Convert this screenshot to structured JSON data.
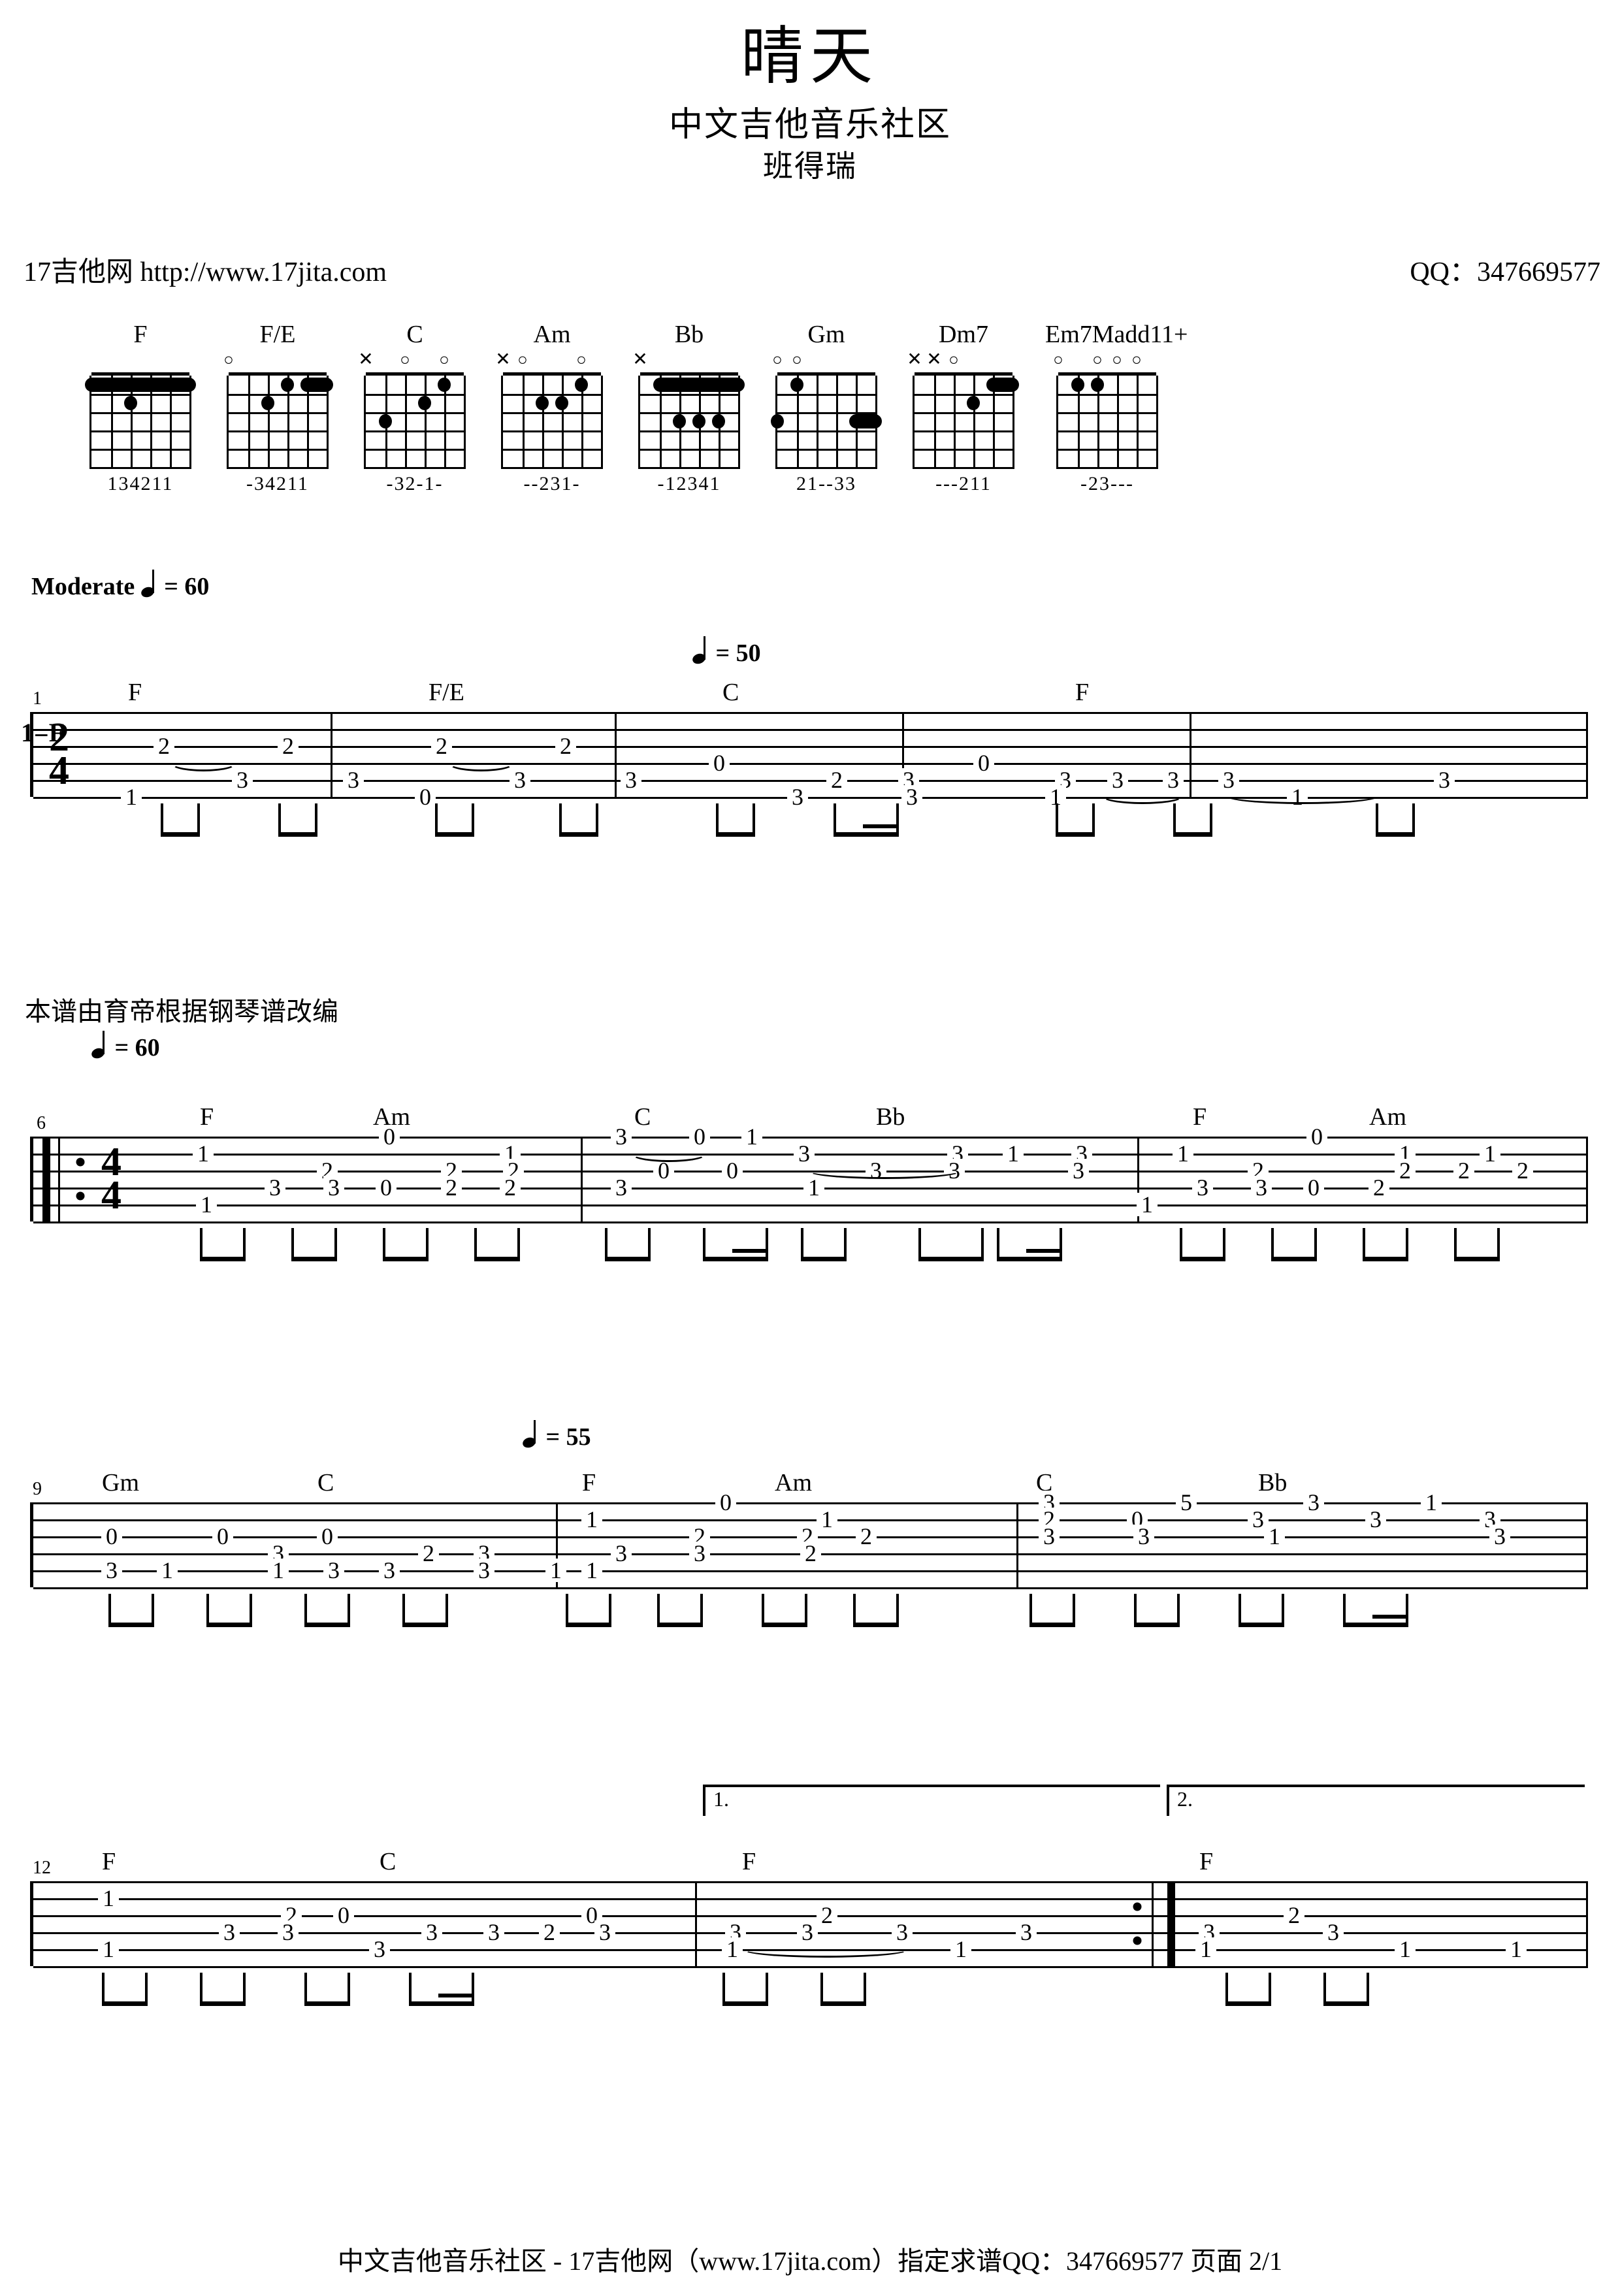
{
  "header": {
    "title": "晴天",
    "subtitle": "中文吉他音乐社区",
    "artist": "班得瑞",
    "site": "17吉他网 http://www.17jita.com",
    "qq": "QQ：347669577"
  },
  "chords": [
    {
      "name": "F",
      "markers": "",
      "fingers": "134211"
    },
    {
      "name": "F/E",
      "markers": "o",
      "fingers": "-34211"
    },
    {
      "name": "C",
      "markers": "x o o",
      "fingers": "-32-1-"
    },
    {
      "name": "Am",
      "markers": "xo  o",
      "fingers": "--231-"
    },
    {
      "name": "Bb",
      "markers": "x",
      "fingers": "-12341"
    },
    {
      "name": "Gm",
      "markers": "oo",
      "fingers": "21--33"
    },
    {
      "name": "Dm7",
      "markers": "xxo",
      "fingers": "---211"
    },
    {
      "name": "Em7Madd11+",
      "markers": "o ooo",
      "fingers": "-23---"
    }
  ],
  "tempo_main": {
    "label": "Moderate",
    "value": "= 60"
  },
  "key_signature": "1=F",
  "annotations": {
    "arranger_note": "本谱由育帝根据钢琴谱改编",
    "tempo_50": "= 50",
    "tempo_60": "= 60",
    "tempo_55": "= 55"
  },
  "systems": [
    {
      "measure_start": "1",
      "time_signature": {
        "top": "2",
        "bottom": "4"
      },
      "chord_labels": [
        "F",
        "F/E",
        "C",
        "F"
      ],
      "frets": [
        [
          "2",
          "2",
          "3",
          "3",
          "1"
        ],
        [
          "2",
          "2",
          "3",
          "3",
          "0"
        ],
        [
          "0",
          "2",
          "3",
          "0",
          "3",
          "3"
        ],
        [
          "3",
          "3",
          "3",
          "3",
          "1",
          "1"
        ]
      ]
    },
    {
      "measure_start": "6",
      "time_signature": {
        "top": "4",
        "bottom": "4"
      },
      "chord_labels": [
        "F",
        "Am",
        "C",
        "Bb",
        "F",
        "Am"
      ],
      "frets": [
        [
          "1",
          "3",
          "3",
          "0",
          "1",
          "2",
          "3",
          "0",
          "2",
          "1",
          "2"
        ],
        [
          "3",
          "0",
          "1",
          "3",
          "0",
          "3",
          "1",
          "3",
          "3",
          "3",
          "1",
          "3"
        ],
        [
          "1",
          "3",
          "3",
          "1",
          "2",
          "0",
          "2",
          "0",
          "1",
          "2",
          "3",
          "2"
        ]
      ]
    },
    {
      "measure_start": "9",
      "chord_labels": [
        "Gm",
        "C",
        "F",
        "Am",
        "C",
        "Bb"
      ],
      "frets": [
        [
          "0",
          "3",
          "0",
          "3",
          "1",
          "0",
          "1",
          "3",
          "2",
          "3"
        ],
        [
          "1",
          "0",
          "2",
          "1",
          "2",
          "3",
          "0",
          "2",
          "3",
          "1"
        ],
        [
          "3",
          "5",
          "3",
          "0",
          "3",
          "3",
          "1",
          "3",
          "3",
          "1"
        ]
      ]
    },
    {
      "measure_start": "12",
      "chord_labels": [
        "F",
        "C",
        "F",
        "F"
      ],
      "volta": [
        "1.",
        "2."
      ],
      "frets": [
        [
          "1",
          "3",
          "1",
          "2",
          "0",
          "3",
          "3",
          "0",
          "2",
          "1"
        ],
        [
          "3",
          "3",
          "2",
          "3",
          "3",
          "3",
          "1",
          "1",
          "2",
          "3",
          "1"
        ]
      ]
    }
  ],
  "footer": "中文吉他音乐社区 - 17吉他网（www.17jita.com）指定求谱QQ：347669577 页面 2/1"
}
